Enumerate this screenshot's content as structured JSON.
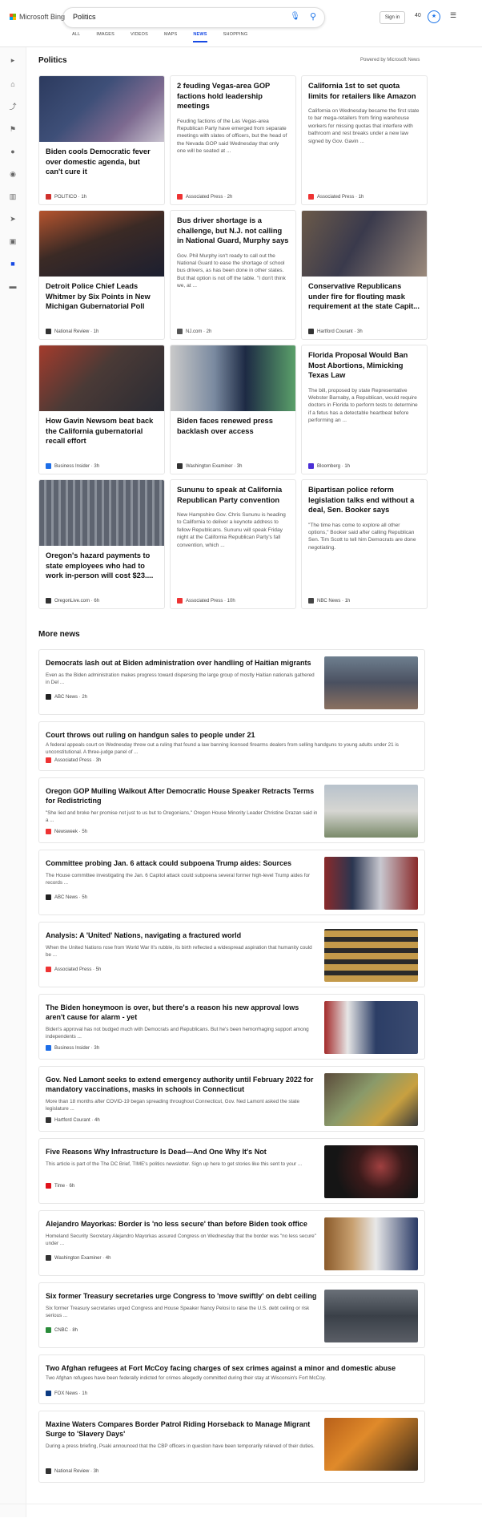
{
  "brand": {
    "name": "Microsoft Bing"
  },
  "search": {
    "query": "Politics"
  },
  "header": {
    "signin": "Sign in",
    "points": "40"
  },
  "tabs": [
    {
      "label": "ALL"
    },
    {
      "label": "IMAGES"
    },
    {
      "label": "VIDEOS"
    },
    {
      "label": "MAPS"
    },
    {
      "label": "NEWS"
    },
    {
      "label": "SHOPPING"
    }
  ],
  "section": {
    "title": "Politics",
    "powered": "Powered by Microsoft News"
  },
  "cards": [
    {
      "title": "Biden cools Democratic fever over domestic agenda, but can't cure it",
      "source": "POLITICO · 1h",
      "src_color": "#d0312d"
    },
    {
      "title": "2 feuding Vegas-area GOP factions hold leadership meetings",
      "desc": "Feuding factions of the Las Vegas-area Republican Party have emerged from separate meetings with slates of officers, but the head of the Nevada GOP said Wednesday that only one will be seated at ...",
      "source": "Associated Press · 2h",
      "src_color": "#e33"
    },
    {
      "title": "California 1st to set quota limits for retailers like Amazon",
      "desc": "California on Wednesday became the first state to bar mega-retailers from firing warehouse workers for missing quotas that interfere with bathroom and rest breaks under a new law signed by Gov. Gavin ...",
      "source": "Associated Press · 1h",
      "src_color": "#e33"
    },
    {
      "title": "Detroit Police Chief Leads Whitmer by Six Points in New Michigan Gubernatorial Poll",
      "source": "National Review · 1h",
      "src_color": "#333"
    },
    {
      "title": "Bus driver shortage is a challenge, but N.J. not calling in National Guard, Murphy says",
      "desc": "Gov. Phil Murphy isn't ready to call out the National Guard to ease the shortage of school bus drivers, as has been done in other states. But that option is not off the table. \"I don't think we, at ...",
      "source": "NJ.com · 2h",
      "src_color": "#555"
    },
    {
      "title": "Conservative Republicans under fire for flouting mask requirement at the state Capit...",
      "source": "Hartford Courant · 3h",
      "src_color": "#333"
    },
    {
      "title": "How Gavin Newsom beat back the California gubernatorial recall effort",
      "source": "Business Insider · 3h",
      "src_color": "#1d6ee8"
    },
    {
      "title": "Biden faces renewed press backlash over access",
      "source": "Washington Examiner · 3h",
      "src_color": "#333"
    },
    {
      "title": "Florida Proposal Would Ban Most Abortions, Mimicking Texas Law",
      "desc": "The bill, proposed by state Representative Webster Barnaby, a Republican, would require doctors in Florida to perform tests to determine if a fetus has a detectable heartbeat before performing an ...",
      "source": "Bloomberg · 1h",
      "src_color": "#4b2fd6"
    },
    {
      "title": "Oregon's hazard payments to state employees who had to work in-person will cost $23....",
      "source": "OregonLive.com · 6h",
      "src_color": "#333"
    },
    {
      "title": "Sununu to speak at California Republican Party convention",
      "desc": "New Hampshire Gov. Chris Sununu is heading to California to deliver a keynote address to fellow Republicans. Sununu will speak Friday night at the California Republican Party's fall convention, which ...",
      "source": "Associated Press · 10h",
      "src_color": "#e33"
    },
    {
      "title": "Bipartisan police reform legislation talks end without a deal, Sen. Booker says",
      "desc": "\"The time has come to explore all other options,\" Booker said after calling Republican Sen. Tim Scott to tell him Democrats are done negotiating.",
      "source": "NBC News · 1h",
      "src_color": "#444"
    }
  ],
  "more": {
    "title": "More news"
  },
  "news": [
    {
      "title": "Democrats lash out at Biden administration over handling of Haitian migrants",
      "desc": "Even as the Biden administration makes progress toward dispersing the large group of mostly Haitian nationals gathered in Del ...",
      "source": "ABC News · 2h",
      "src_color": "#222"
    },
    {
      "title": "Court throws out ruling on handgun sales to people under 21",
      "desc": "A federal appeals court on Wednesday threw out a ruling that found a law banning licensed firearms dealers from selling handguns to young adults under 21 is unconstitutional. A three-judge panel of ...",
      "source": "Associated Press · 3h",
      "src_color": "#e33"
    },
    {
      "title": "Oregon GOP Mulling Walkout After Democratic House Speaker Retracts Terms for Redistricting",
      "desc": "\"She lied and broke her promise not just to us but to Oregonians,\" Oregon House Minority Leader Christine Drazan said in a ...",
      "source": "Newsweek · 5h",
      "src_color": "#e33"
    },
    {
      "title": "Committee probing Jan. 6 attack could subpoena Trump aides: Sources",
      "desc": "The House committee investigating the Jan. 6 Capitol attack could subpoena several former high-level Trump aides for records ...",
      "source": "ABC News · 5h",
      "src_color": "#222"
    },
    {
      "title": "Analysis: A 'United' Nations, navigating a fractured world",
      "desc": "When the United Nations rose from World War II's rubble, its birth reflected a widespread aspiration that humanity could be ...",
      "source": "Associated Press · 5h",
      "src_color": "#e33"
    },
    {
      "title": "The Biden honeymoon is over, but there's a reason his new approval lows aren't cause for alarm - yet",
      "desc": "Biden's approval has not budged much with Democrats and Republicans. But he's been hemorrhaging support among independents ...",
      "source": "Business Insider · 3h",
      "src_color": "#1d6ee8"
    },
    {
      "title": "Gov. Ned Lamont seeks to extend emergency authority until February 2022 for mandatory vaccinations, masks in schools in Connecticut",
      "desc": "More than 18 months after COVID-19 began spreading throughout Connecticut, Gov. Ned Lamont asked the state legislature ...",
      "source": "Hartford Courant · 4h",
      "src_color": "#333"
    },
    {
      "title": "Five Reasons Why Infrastructure Is Dead—And One Why It's Not",
      "desc": "This article is part of the The DC Brief, TIME's politics newsletter. Sign up here to get stories like this sent to your ...",
      "source": "Time · 6h",
      "src_color": "#e0121b"
    },
    {
      "title": "Alejandro Mayorkas: Border is 'no less secure' than before Biden took office",
      "desc": "Homeland Security Secretary Alejandro Mayorkas assured Congress on Wednesday that the border was \"no less secure\" under ...",
      "source": "Washington Examiner · 4h",
      "src_color": "#333"
    },
    {
      "title": "Six former Treasury secretaries urge Congress to 'move swiftly' on debt ceiling",
      "desc": "Six former Treasury secretaries urged Congress and House Speaker Nancy Pelosi to raise the U.S. debt ceiling or risk serious ...",
      "source": "CNBC · 8h",
      "src_color": "#2a8c3a"
    },
    {
      "title": "Two Afghan refugees at Fort McCoy facing charges of sex crimes against a minor and domestic abuse",
      "desc": "Two Afghan refugees have been federally indicted for crimes allegedly committed during their stay at Wisconsin's Fort McCoy.",
      "source": "FOX News · 1h",
      "src_color": "#0b3a82"
    },
    {
      "title": "Maxine Waters Compares Border Patrol Riding Horseback to Manage Migrant Surge to 'Slavery Days'",
      "desc": "During a press briefing, Psaki announced that the CBP officers in question have been temporarily relieved of their duties.",
      "source": "National Review · 3h",
      "src_color": "#333"
    }
  ]
}
